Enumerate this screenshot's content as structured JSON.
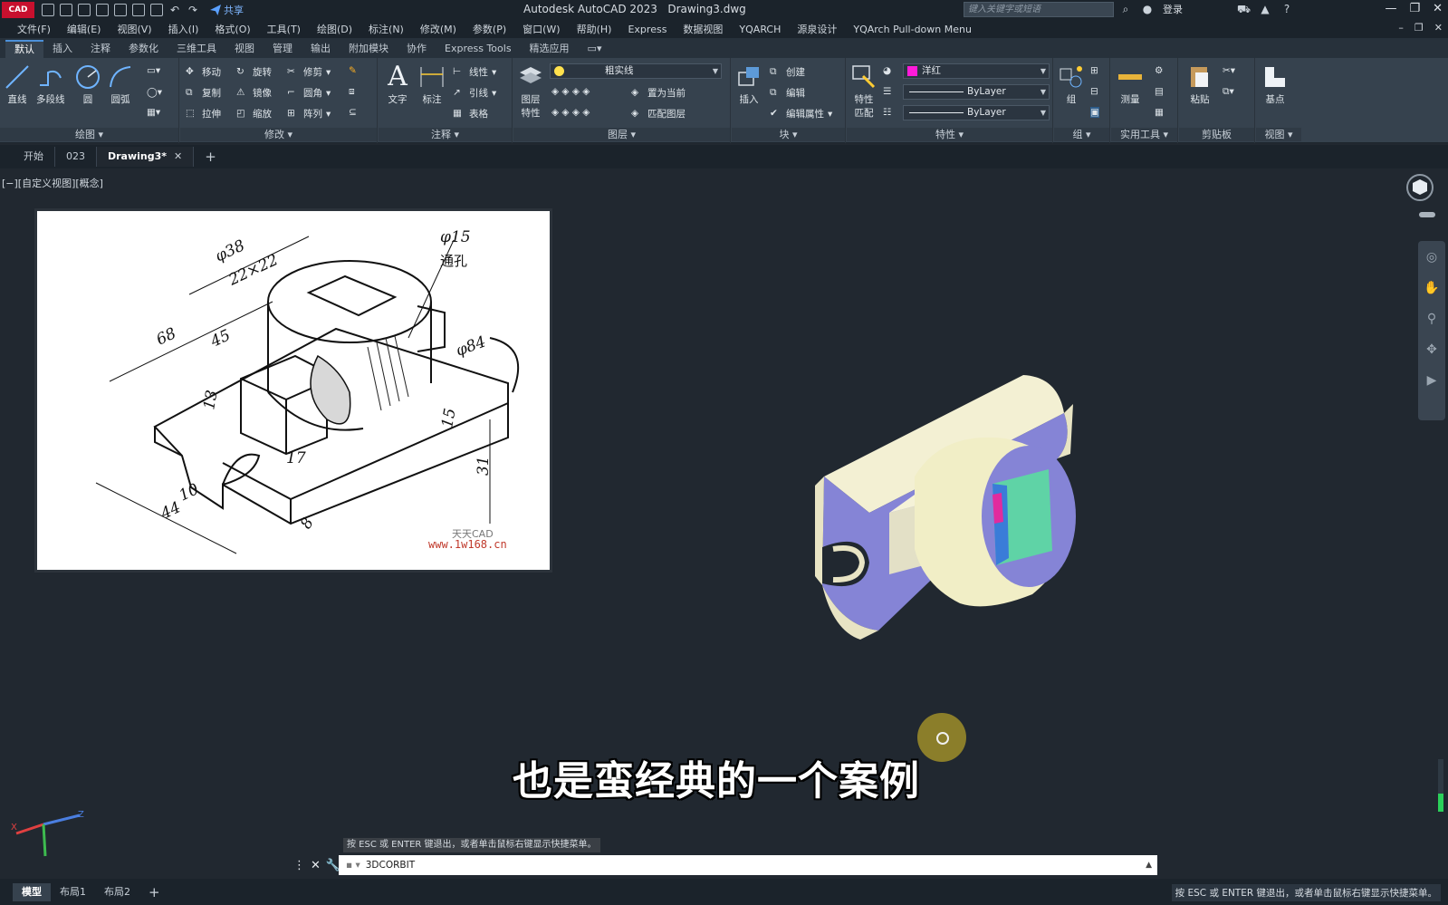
{
  "titlebar": {
    "app_logo": "CAD",
    "share_label": "共享",
    "app_title": "Autodesk AutoCAD 2023",
    "file_name": "Drawing3.dwg",
    "search_placeholder": "键入关键字或短语",
    "login_label": "登录"
  },
  "menubar": {
    "items": [
      "文件(F)",
      "编辑(E)",
      "视图(V)",
      "插入(I)",
      "格式(O)",
      "工具(T)",
      "绘图(D)",
      "标注(N)",
      "修改(M)",
      "参数(P)",
      "窗口(W)",
      "帮助(H)",
      "Express",
      "数据视图",
      "YQARCH",
      "源泉设计",
      "YQArch Pull-down Menu"
    ]
  },
  "ribbon_tabs": [
    "默认",
    "插入",
    "注释",
    "参数化",
    "三维工具",
    "视图",
    "管理",
    "输出",
    "附加模块",
    "协作",
    "Express Tools",
    "精选应用"
  ],
  "ribbon": {
    "draw": {
      "title": "绘图",
      "line": "直线",
      "polyline": "多段线",
      "circle": "圆",
      "arc": "圆弧"
    },
    "modify": {
      "title": "修改",
      "move": "移动",
      "rotate": "旋转",
      "trim": "修剪",
      "copy": "复制",
      "mirror": "镜像",
      "fillet": "圆角",
      "stretch": "拉伸",
      "scale": "缩放",
      "array": "阵列"
    },
    "annotation": {
      "title": "注释",
      "text": "文字",
      "dimension": "标注",
      "linear": "线性",
      "leader": "引线",
      "table": "表格"
    },
    "layers": {
      "title": "图层",
      "layer_props": "图层特性",
      "current_layer": "粗实线",
      "set_current": "置为当前",
      "match_layer": "匹配图层"
    },
    "block": {
      "title": "块",
      "insert": "插入",
      "create": "创建",
      "edit": "编辑",
      "edit_attr": "编辑属性"
    },
    "properties": {
      "title": "特性",
      "match": "特性匹配",
      "color": "洋红",
      "color_hex": "#ff1ad9",
      "linetype": "ByLayer",
      "lineweight": "ByLayer"
    },
    "groups": {
      "title": "组",
      "group": "组"
    },
    "utilities": {
      "title": "实用工具",
      "measure": "测量"
    },
    "clipboard": {
      "title": "剪贴板",
      "paste": "粘贴"
    },
    "view": {
      "title": "视图",
      "base": "基点"
    }
  },
  "doc_tabs": [
    {
      "label": "开始",
      "active": false
    },
    {
      "label": "023",
      "active": false
    },
    {
      "label": "Drawing3*",
      "active": true
    }
  ],
  "viewport": {
    "label": "[−][自定义视图][概念]",
    "subtitle": "也是蛮经典的一个案例"
  },
  "reference_drawing": {
    "dims": [
      "φ15",
      "通孔",
      "φ38",
      "22×22",
      "68",
      "45",
      "φ84",
      "13",
      "15",
      "31",
      "17",
      "10",
      "44",
      "8"
    ],
    "watermark_1": "天天CAD",
    "watermark_2": "www.1w168.cn"
  },
  "command": {
    "hint": "按 ESC 或 ENTER 键退出，或者单击鼠标右键显示快捷菜单。",
    "value": "3DCORBIT"
  },
  "statusbar": {
    "tabs": [
      "模型",
      "布局1",
      "布局2"
    ],
    "right_text": "按 ESC 或 ENTER 键退出，或者单击鼠标右键显示快捷菜单。"
  }
}
